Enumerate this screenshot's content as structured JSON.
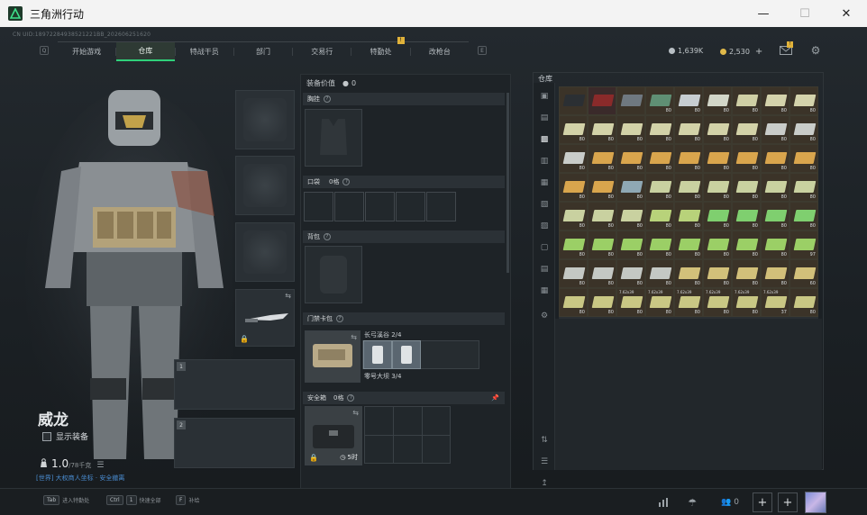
{
  "window": {
    "title": "三角洲行动"
  },
  "uid_text": "CN UID:18972284938521221BB_202606251620",
  "nav": {
    "left_key": "Q",
    "right_key": "E",
    "tabs": [
      {
        "label": "开始游戏",
        "active": false
      },
      {
        "label": "仓库",
        "active": true
      },
      {
        "label": "特战干员",
        "active": false
      },
      {
        "label": "部门",
        "active": false
      },
      {
        "label": "交易行",
        "active": false
      },
      {
        "label": "特勤处",
        "active": false,
        "badge": "!"
      },
      {
        "label": "改枪台",
        "active": false
      }
    ]
  },
  "currency": {
    "hafcoin": "1,639K",
    "tokens": "2,530",
    "plus": "+",
    "coin_color": "#b8bfc4",
    "token_color": "#e0b94a"
  },
  "mail_badge": "!",
  "operator": {
    "name": "威龙",
    "show_gear_label": "显示装备",
    "weight_value": "1.0",
    "weight_max": "/78千克",
    "channel_text": "[世界] 大权商人坐标 · 安全撤离"
  },
  "weapon_slots": [
    "1",
    "2"
  ],
  "equipment": {
    "header_label": "装备价值",
    "header_value": "0",
    "rig_label": "胸挂",
    "pocket_label": "口袋",
    "pocket_capacity": "0格",
    "backpack_label": "背包",
    "keycard_label": "门禁卡包",
    "keycard_line1": "长弓溪谷 2/4",
    "keycard_line2": "零号大坝 3/4",
    "safebox_label": "安全箱",
    "safebox_capacity": "0格",
    "safebox_timer": "5时"
  },
  "inventory": {
    "label": "仓库",
    "cells": [
      {
        "tag": "",
        "qty": "",
        "color": "#2b2f33",
        "bg": "#3b3328"
      },
      {
        "tag": "",
        "qty": "",
        "color": "#8a2a2a",
        "bg": "#3a2a2a"
      },
      {
        "tag": "",
        "qty": "",
        "color": "#6f7880",
        "bg": "#3b3328"
      },
      {
        "tag": "",
        "qty": "80",
        "color": "#5f8f74",
        "bg": "#3b3328"
      },
      {
        "tag": "",
        "qty": "80",
        "color": "#c7cdd1",
        "bg": "#3b3328"
      },
      {
        "tag": "",
        "qty": "80",
        "color": "#d2d6c8",
        "bg": "#3b3328"
      },
      {
        "tag": "",
        "qty": "80",
        "color": "#cfcfa5",
        "bg": "#3b3328"
      },
      {
        "tag": "",
        "qty": "80",
        "color": "#d4d3ac",
        "bg": "#3b3328"
      },
      {
        "tag": "",
        "qty": "80",
        "color": "#d4d3ac",
        "bg": "#3b3328"
      },
      {
        "tag": "",
        "qty": "80",
        "color": "#d3d2a8",
        "bg": "#3b3328"
      },
      {
        "tag": "",
        "qty": "80",
        "color": "#d3d2a8",
        "bg": "#3b3328"
      },
      {
        "tag": "",
        "qty": "80",
        "color": "#d3d2a8",
        "bg": "#3b3328"
      },
      {
        "tag": "",
        "qty": "80",
        "color": "#d3d2a8",
        "bg": "#3b3328"
      },
      {
        "tag": "",
        "qty": "80",
        "color": "#d3d2a8",
        "bg": "#3b3328"
      },
      {
        "tag": "",
        "qty": "80",
        "color": "#d3d2a8",
        "bg": "#3b3328"
      },
      {
        "tag": "",
        "qty": "80",
        "color": "#d3d2a8",
        "bg": "#3b3328"
      },
      {
        "tag": "",
        "qty": "80",
        "color": "#c9ccc9",
        "bg": "#3b3328"
      },
      {
        "tag": "",
        "qty": "80",
        "color": "#c9ccc9",
        "bg": "#3b3328"
      },
      {
        "tag": "",
        "qty": "80",
        "color": "#c9ccc9",
        "bg": "#3b3328"
      },
      {
        "tag": "",
        "qty": "80",
        "color": "#d9a54d",
        "bg": "#3b3328"
      },
      {
        "tag": "",
        "qty": "80",
        "color": "#d9a54d",
        "bg": "#3b3328"
      },
      {
        "tag": "",
        "qty": "80",
        "color": "#d9a54d",
        "bg": "#3b3328"
      },
      {
        "tag": "",
        "qty": "80",
        "color": "#d9a54d",
        "bg": "#3b3328"
      },
      {
        "tag": "",
        "qty": "80",
        "color": "#d9a54d",
        "bg": "#3b3328"
      },
      {
        "tag": "",
        "qty": "80",
        "color": "#d9a54d",
        "bg": "#3b3328"
      },
      {
        "tag": "",
        "qty": "80",
        "color": "#d9a54d",
        "bg": "#3b3328"
      },
      {
        "tag": "",
        "qty": "80",
        "color": "#d9a54d",
        "bg": "#3b3328"
      },
      {
        "tag": "",
        "qty": "80",
        "color": "#d9a54d",
        "bg": "#3b3328"
      },
      {
        "tag": "",
        "qty": "80",
        "color": "#d9a54d",
        "bg": "#3b3328"
      },
      {
        "tag": "",
        "qty": "80",
        "color": "#8fa8b4",
        "bg": "#3b3328"
      },
      {
        "tag": "",
        "qty": "80",
        "color": "#c9d1a0",
        "bg": "#3b3328"
      },
      {
        "tag": "",
        "qty": "80",
        "color": "#c9d1a0",
        "bg": "#3b3328"
      },
      {
        "tag": "",
        "qty": "80",
        "color": "#c9d1a0",
        "bg": "#3b3328"
      },
      {
        "tag": "",
        "qty": "80",
        "color": "#c9d1a0",
        "bg": "#3b3328"
      },
      {
        "tag": "",
        "qty": "80",
        "color": "#c9d1a0",
        "bg": "#3b3328"
      },
      {
        "tag": "",
        "qty": "80",
        "color": "#c9d1a0",
        "bg": "#3b3328"
      },
      {
        "tag": "",
        "qty": "80",
        "color": "#c9d1a0",
        "bg": "#3b3328"
      },
      {
        "tag": "",
        "qty": "80",
        "color": "#c9d1a0",
        "bg": "#3b3328"
      },
      {
        "tag": "",
        "qty": "80",
        "color": "#c9d1a0",
        "bg": "#3b3328"
      },
      {
        "tag": "",
        "qty": "80",
        "color": "#b8d27a",
        "bg": "#3b3328"
      },
      {
        "tag": "",
        "qty": "80",
        "color": "#b8d27a",
        "bg": "#3b3328"
      },
      {
        "tag": "",
        "qty": "80",
        "color": "#7fcf6f",
        "bg": "#3b3328"
      },
      {
        "tag": "",
        "qty": "80",
        "color": "#7fcf6f",
        "bg": "#3b3328"
      },
      {
        "tag": "",
        "qty": "80",
        "color": "#7fcf6f",
        "bg": "#3b3328"
      },
      {
        "tag": "",
        "qty": "80",
        "color": "#7fcf6f",
        "bg": "#3b3328"
      },
      {
        "tag": "",
        "qty": "80",
        "color": "#9bcf66",
        "bg": "#3b3328"
      },
      {
        "tag": "",
        "qty": "80",
        "color": "#9bcf66",
        "bg": "#3b3328"
      },
      {
        "tag": "",
        "qty": "80",
        "color": "#9bcf66",
        "bg": "#3b3328"
      },
      {
        "tag": "",
        "qty": "80",
        "color": "#9bcf66",
        "bg": "#3b3328"
      },
      {
        "tag": "",
        "qty": "80",
        "color": "#9bcf66",
        "bg": "#3b3328"
      },
      {
        "tag": "",
        "qty": "80",
        "color": "#9bcf66",
        "bg": "#3b3328"
      },
      {
        "tag": "",
        "qty": "80",
        "color": "#9bcf66",
        "bg": "#3b3328"
      },
      {
        "tag": "",
        "qty": "80",
        "color": "#9bcf66",
        "bg": "#3b3328"
      },
      {
        "tag": "",
        "qty": "97",
        "color": "#9bcf66",
        "bg": "#3b3328"
      },
      {
        "tag": "",
        "qty": "80",
        "color": "#c4c8c4",
        "bg": "#3b3328"
      },
      {
        "tag": "",
        "qty": "80",
        "color": "#c4c8c4",
        "bg": "#3b3328"
      },
      {
        "tag": "",
        "qty": "80",
        "color": "#c4c8c4",
        "bg": "#3b3328"
      },
      {
        "tag": "",
        "qty": "80",
        "color": "#c4c8c4",
        "bg": "#3b3328"
      },
      {
        "tag": "",
        "qty": "80",
        "color": "#d2c07a",
        "bg": "#3b3328"
      },
      {
        "tag": "",
        "qty": "80",
        "color": "#d2c07a",
        "bg": "#3b3328"
      },
      {
        "tag": "",
        "qty": "80",
        "color": "#d2c07a",
        "bg": "#3b3328"
      },
      {
        "tag": "",
        "qty": "80",
        "color": "#d2c07a",
        "bg": "#3b3328"
      },
      {
        "tag": "",
        "qty": "60",
        "color": "#d2c07a",
        "bg": "#3b3328"
      },
      {
        "tag": "",
        "qty": "80",
        "color": "#c9c784",
        "bg": "#3b3328"
      },
      {
        "tag": "",
        "qty": "80",
        "color": "#c9c784",
        "bg": "#3b3328"
      },
      {
        "tag": "7.62x39",
        "qty": "80",
        "color": "#c9c784",
        "bg": "#3b3328"
      },
      {
        "tag": "7.62x39",
        "qty": "80",
        "color": "#c9c784",
        "bg": "#3b3328"
      },
      {
        "tag": "7.62x39",
        "qty": "80",
        "color": "#c9c784",
        "bg": "#3b3328"
      },
      {
        "tag": "7.62x39",
        "qty": "80",
        "color": "#c9c784",
        "bg": "#3b3328"
      },
      {
        "tag": "7.62x39",
        "qty": "80",
        "color": "#c9c784",
        "bg": "#3b3328"
      },
      {
        "tag": "7.62x39",
        "qty": "37",
        "color": "#c9c784",
        "bg": "#3b3328"
      },
      {
        "tag": "",
        "qty": "80",
        "color": "#c9c784",
        "bg": "#3b3328"
      }
    ]
  },
  "bottom": {
    "hints": [
      {
        "key": "Tab",
        "label": "进入特勤处"
      },
      {
        "key": "Ctrl",
        "key2": "1",
        "label": "快速全部"
      },
      {
        "key": "F",
        "label": "补给"
      }
    ],
    "friends_count": "0",
    "add1": "+",
    "add2": "+"
  },
  "icons": {
    "minimize": "minimize-icon",
    "maximize": "maximize-icon",
    "close": "close-icon",
    "mail": "mail-icon",
    "settings": "gear-icon"
  }
}
